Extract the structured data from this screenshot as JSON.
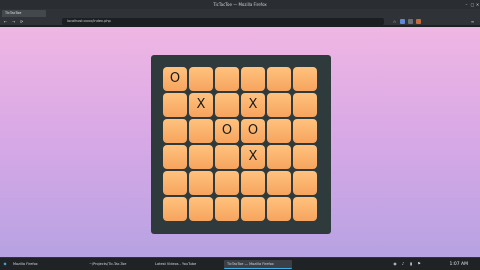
{
  "window": {
    "title": "TicTacToe — Mozilla Firefox"
  },
  "browser": {
    "tab_label": "TicTacToe",
    "url": "localhost:xxxx/Index.php"
  },
  "game": {
    "rows": [
      [
        "O",
        "",
        "",
        "",
        "",
        ""
      ],
      [
        "",
        "X",
        "",
        "X",
        "",
        ""
      ],
      [
        "",
        "",
        "O",
        "O",
        "",
        ""
      ],
      [
        "",
        "",
        "",
        "X",
        "",
        ""
      ],
      [
        "",
        "",
        "",
        "",
        "",
        ""
      ],
      [
        "",
        "",
        "",
        "",
        "",
        ""
      ]
    ]
  },
  "taskbar": {
    "items": [
      {
        "label": "Mozilla Firefox"
      },
      {
        "label": "~/Projects/Tic-Tac-Toe"
      },
      {
        "label": "Latest Videos - YouTube"
      },
      {
        "label": "TicTacToe — Mozilla Firefox"
      }
    ],
    "time": "1:07 AM"
  },
  "colors": {
    "board": "#2f3a3d",
    "cell": "#ffc27e",
    "page_top": "#efb6e3",
    "page_bottom": "#b7a2e2",
    "accent": "#3daee9"
  }
}
